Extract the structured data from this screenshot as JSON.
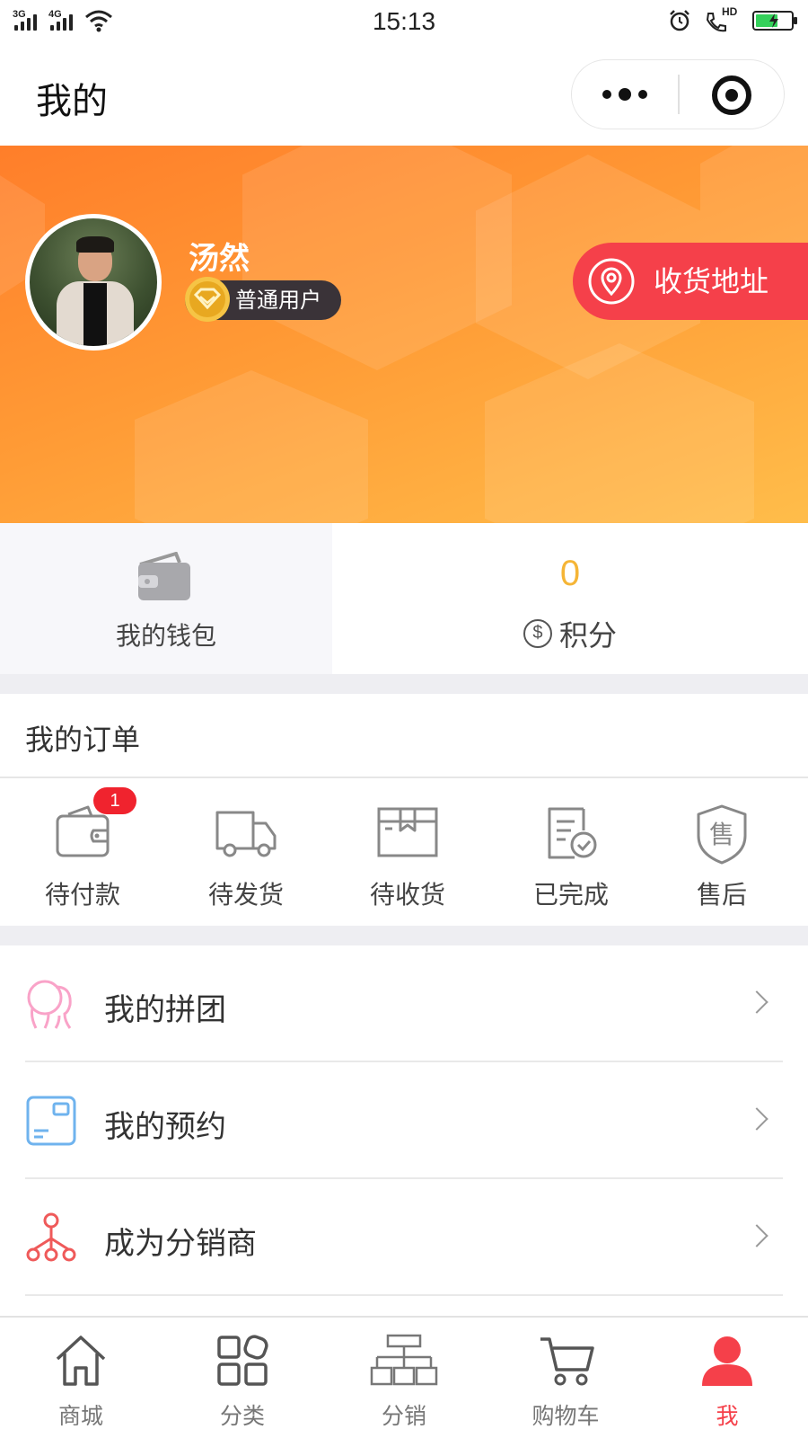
{
  "status_bar": {
    "time": "15:13",
    "network_1": "3G",
    "network_2": "4G",
    "call_label": "HD"
  },
  "header": {
    "title": "我的"
  },
  "profile": {
    "name": "汤然",
    "member_level": "普通用户",
    "address_button": "收货地址"
  },
  "stats": {
    "wallet_label": "我的钱包",
    "points_value": "0",
    "points_label": "积分",
    "points_icon_symbol": "$"
  },
  "orders": {
    "title": "我的订单",
    "items": [
      {
        "label": "待付款",
        "icon": "wallet-icon",
        "badge": "1"
      },
      {
        "label": "待发货",
        "icon": "truck-icon"
      },
      {
        "label": "待收货",
        "icon": "package-icon"
      },
      {
        "label": "已完成",
        "icon": "completed-document-icon"
      },
      {
        "label": "售后",
        "icon": "after-sales-shield-icon",
        "icon_text": "售"
      }
    ]
  },
  "menu": {
    "items": [
      {
        "label": "我的拼团",
        "icon": "group-buy-icon"
      },
      {
        "label": "我的预约",
        "icon": "reservation-card-icon"
      },
      {
        "label": "成为分销商",
        "icon": "distribution-network-icon"
      }
    ]
  },
  "tab_bar": {
    "active": "我",
    "items": [
      {
        "label": "商城",
        "icon": "home-icon"
      },
      {
        "label": "分类",
        "icon": "category-grid-icon"
      },
      {
        "label": "分销",
        "icon": "hierarchy-icon"
      },
      {
        "label": "购物车",
        "icon": "cart-icon"
      },
      {
        "label": "我",
        "icon": "user-icon"
      }
    ]
  },
  "colors": {
    "accent_red": "#f5404a",
    "points_yellow": "#f5b536",
    "header_gradient_start": "#ff7e2a",
    "header_gradient_end": "#ffbd4a",
    "badge_red": "#f0232e"
  }
}
